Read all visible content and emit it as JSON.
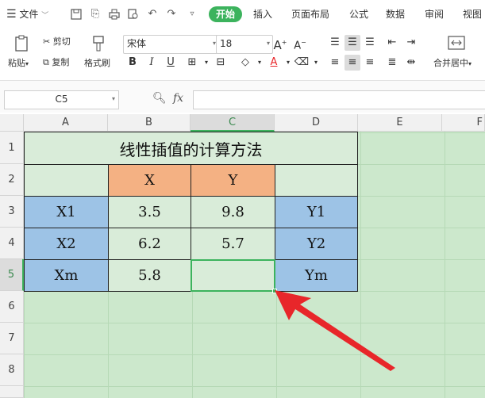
{
  "menu": {
    "file_label": "文件",
    "tabs": [
      {
        "label": "开始"
      },
      {
        "label": "插入"
      },
      {
        "label": "页面布局"
      },
      {
        "label": "公式"
      },
      {
        "label": "数据"
      },
      {
        "label": "审阅"
      },
      {
        "label": "视图"
      }
    ]
  },
  "ribbon": {
    "paste_label": "粘贴",
    "cut_label": "剪切",
    "copy_label": "复制",
    "format_painter_label": "格式刷",
    "font_name": "宋体",
    "font_size": "18",
    "merge_label": "合并居中"
  },
  "formula_bar": {
    "name_box": "C5",
    "fx_label": "fx",
    "formula": ""
  },
  "columns": [
    "A",
    "B",
    "C",
    "D",
    "E",
    "F"
  ],
  "rows": [
    "1",
    "2",
    "3",
    "4",
    "5",
    "6",
    "7",
    "8"
  ],
  "sheet": {
    "title": "线性插值的计算方法",
    "header_x": "X",
    "header_y": "Y",
    "x1": "X1",
    "x1_val": "3.5",
    "y1_val": "9.8",
    "y1": "Y1",
    "x2": "X2",
    "x2_val": "6.2",
    "y2_val": "5.7",
    "y2": "Y2",
    "xm": "Xm",
    "xm_val": "5.8",
    "ym_val": "",
    "ym": "Ym"
  },
  "colors": {
    "accent_green": "#3cb35d",
    "sheet_bg": "#cce8cc",
    "header_orange": "#f4b183",
    "label_blue": "#9dc3e6",
    "value_green": "#d9ecd9",
    "arrow_red": "#e8262a"
  }
}
